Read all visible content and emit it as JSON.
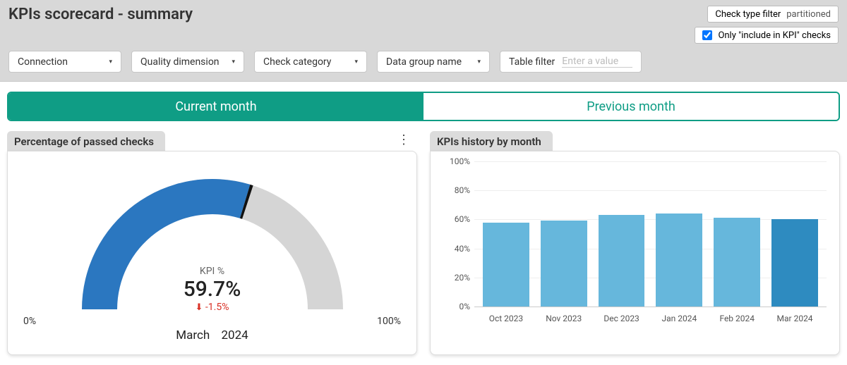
{
  "header": {
    "title": "KPIs scorecard - summary",
    "check_type_filter_label": "Check type filter",
    "check_type_filter_value": "partitioned",
    "include_kpi_checkbox_label": "Only \"include in KPI\" checks",
    "include_kpi_checked": true
  },
  "filters": {
    "connection": "Connection",
    "quality_dimension": "Quality dimension",
    "check_category": "Check category",
    "data_group_name": "Data group name",
    "table_filter_label": "Table filter",
    "table_filter_placeholder": "Enter a value"
  },
  "tabs": {
    "current": "Current month",
    "previous": "Previous month",
    "active": "current"
  },
  "gauge_panel": {
    "title": "Percentage of passed checks",
    "kpi_label": "KPI %",
    "kpi_value": "59.7%",
    "delta": "-1.5%",
    "date_month": "March",
    "date_year": "2024",
    "min_label": "0%",
    "max_label": "100%"
  },
  "history_panel": {
    "title": "KPIs history by month"
  },
  "colors": {
    "accent": "#0f9d85",
    "gauge_fill": "#2b77c0",
    "gauge_bg": "#d5d5d5",
    "bar": "#66b7dc",
    "bar_current": "#2e8bc0",
    "delta_down": "#d93025"
  },
  "chart_data": [
    {
      "type": "gauge",
      "title": "Percentage of passed checks",
      "value": 59.7,
      "min": 0,
      "max": 100,
      "unit": "%",
      "delta": -1.5,
      "period": "March 2024"
    },
    {
      "type": "bar",
      "title": "KPIs history by month",
      "ylabel": "",
      "ylim": [
        0,
        100
      ],
      "y_ticks": [
        "0%",
        "20%",
        "40%",
        "60%",
        "80%",
        "100%"
      ],
      "categories": [
        "Oct 2023",
        "Nov 2023",
        "Dec 2023",
        "Jan 2024",
        "Feb 2024",
        "Mar 2024"
      ],
      "values": [
        58,
        59,
        63,
        64,
        61,
        60
      ],
      "highlight_index": 5
    }
  ]
}
